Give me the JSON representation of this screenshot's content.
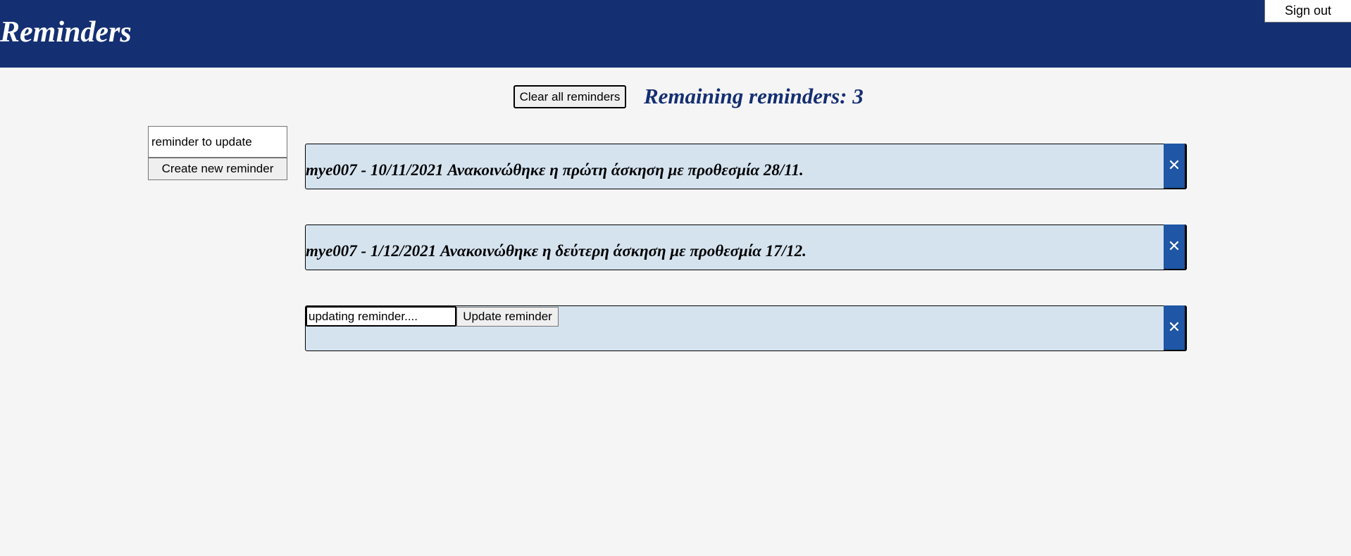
{
  "header": {
    "title": "Reminders",
    "signout_label": "Sign out",
    "background_color": "#142f72"
  },
  "toolbar": {
    "clear_label": "Clear all reminders",
    "remaining_text": "Remaining reminders: 3"
  },
  "create_form": {
    "input_value": "reminder to update",
    "create_label": "Create new reminder"
  },
  "reminders": [
    {
      "text": "mye007 - 10/11/2021 Ανακοινώθηκε η πρώτη άσκηση με προθεσμία 28/11."
    },
    {
      "text": "mye007 - 1/12/2021 Ανακοινώθηκε η δεύτερη άσκηση με προθεσμία 17/12."
    },
    {
      "editing": true,
      "update_input_value": "updating reminder....",
      "update_label": "Update reminder"
    }
  ],
  "remove_icon": "close-icon",
  "remove_glyph": "✕",
  "colors": {
    "reminder_background": "#d5e3ef",
    "remove_button": "#1f56a5",
    "accent_text": "#142f72"
  }
}
